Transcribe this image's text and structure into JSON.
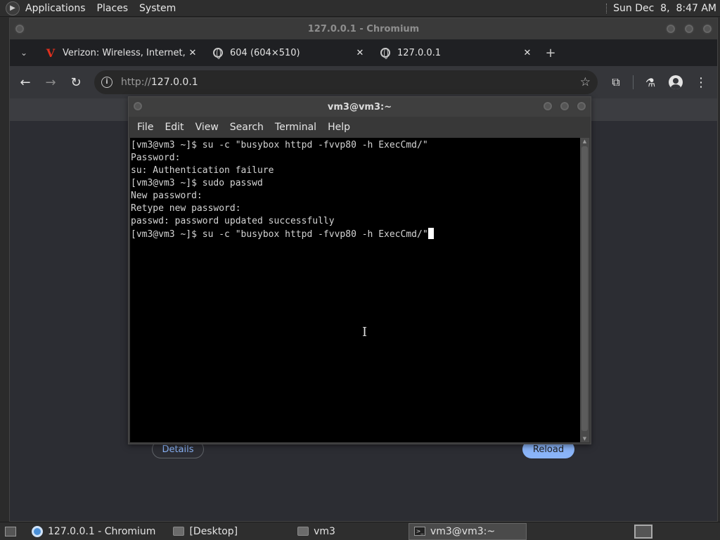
{
  "top_panel": {
    "menus": [
      "Applications",
      "Places",
      "System"
    ],
    "clock": "Sun Dec  8,  8:47 AM"
  },
  "chromium": {
    "window_title": "127.0.0.1 - Chromium",
    "tabs": [
      {
        "title": "Verizon: Wireless, Internet, T",
        "icon": "verizon-icon",
        "close": "✕"
      },
      {
        "title": "604 (604×510)",
        "icon": "globe-icon",
        "close": "✕"
      },
      {
        "title": "127.0.0.1",
        "icon": "globe-icon",
        "close": "✕"
      }
    ],
    "new_tab": "+",
    "url_scheme": "http://",
    "url_host": "127.0.0.1",
    "page": {
      "details_label": "Details",
      "reload_label": "Reload"
    }
  },
  "terminal": {
    "window_title": "vm3@vm3:~",
    "menus": [
      "File",
      "Edit",
      "View",
      "Search",
      "Terminal",
      "Help"
    ],
    "lines": [
      "[vm3@vm3 ~]$ su -c \"busybox httpd -fvvp80 -h ExecCmd/\"",
      "Password:",
      "su: Authentication failure",
      "[vm3@vm3 ~]$ sudo passwd",
      "New password:",
      "Retype new password:",
      "passwd: password updated successfully",
      "[vm3@vm3 ~]$ su -c \"busybox httpd -fvvp80 -h ExecCmd/\""
    ]
  },
  "taskbar": {
    "items": [
      {
        "label": "127.0.0.1 - Chromium",
        "icon": "chromium-icon"
      },
      {
        "label": "[Desktop]",
        "icon": "folder-icon"
      },
      {
        "label": "vm3",
        "icon": "home-folder-icon"
      },
      {
        "label": "vm3@vm3:~",
        "icon": "terminal-icon"
      }
    ]
  },
  "colors": {
    "accent": "#8ab4f8",
    "terminal_bg": "#000000",
    "verizon_red": "#e0301e"
  }
}
